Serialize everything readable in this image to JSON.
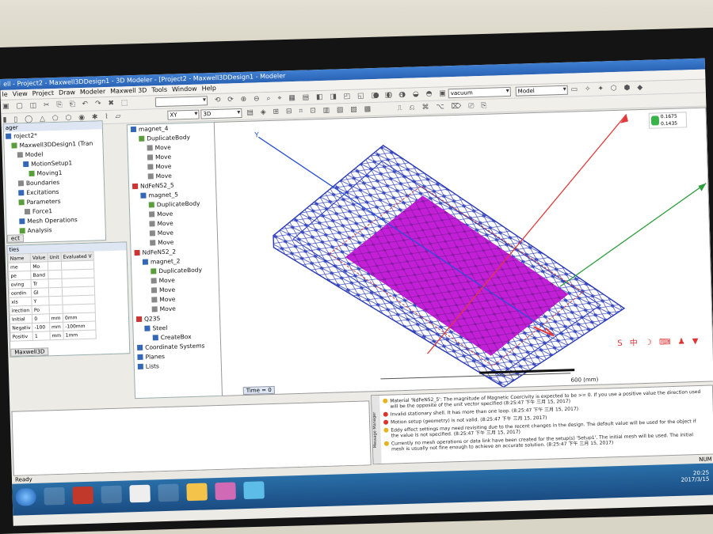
{
  "window": {
    "title": "ell - Project2 - Maxwell3DDesign1 - 3D Modeler - [Project2 - Maxwell3DDesign1 - Modeler"
  },
  "menu": [
    "le",
    "View",
    "Project",
    "Draw",
    "Modeler",
    "Maxwell 3D",
    "Tools",
    "Window",
    "Help"
  ],
  "toolbar": {
    "material_combo": "vacuum",
    "model_combo": "Model",
    "zoom_combo": "3D",
    "grid_combo": "XY"
  },
  "project_manager": {
    "header": "ager",
    "items": [
      "roject2*",
      "Maxwell3DDesign1 (Tran",
      "Model",
      "MotionSetup1",
      "Moving1",
      "Boundaries",
      "Excitations",
      "Parameters",
      "Force1",
      "Mesh Operations",
      "Analysis"
    ],
    "tab": "ect"
  },
  "properties": {
    "header": "ties",
    "columns": [
      "Name",
      "Value",
      "Unit",
      "Evaluated V"
    ],
    "rows": [
      [
        "me",
        "Mo",
        "",
        ""
      ],
      [
        "pe",
        "Band",
        "",
        ""
      ],
      [
        "oving",
        "Tr",
        "",
        ""
      ],
      [
        "oordin",
        "Gl",
        "",
        ""
      ],
      [
        "xis",
        "Y",
        "",
        ""
      ],
      [
        "irection",
        "Po",
        "",
        ""
      ],
      [
        "Initial",
        "0",
        "mm",
        "0mm"
      ],
      [
        "Negativ",
        "-100",
        "mm",
        "-100mm"
      ],
      [
        "Positiv",
        "1",
        "mm",
        "1mm"
      ]
    ],
    "tab": "Maxwell3D"
  },
  "history_tree": {
    "items": [
      {
        "label": "magnet_4",
        "indent": 0
      },
      {
        "label": "DuplicateBody",
        "indent": 1
      },
      {
        "label": "Move",
        "indent": 2
      },
      {
        "label": "Move",
        "indent": 2
      },
      {
        "label": "Move",
        "indent": 2
      },
      {
        "label": "Move",
        "indent": 2
      },
      {
        "label": "NdFeN52_5",
        "indent": 0
      },
      {
        "label": "magnet_5",
        "indent": 1
      },
      {
        "label": "DuplicateBody",
        "indent": 2
      },
      {
        "label": "Move",
        "indent": 2
      },
      {
        "label": "Move",
        "indent": 2
      },
      {
        "label": "Move",
        "indent": 2
      },
      {
        "label": "Move",
        "indent": 2
      },
      {
        "label": "NdFeN52_2",
        "indent": 0
      },
      {
        "label": "magnet_2",
        "indent": 1
      },
      {
        "label": "DuplicateBody",
        "indent": 2
      },
      {
        "label": "Move",
        "indent": 2
      },
      {
        "label": "Move",
        "indent": 2
      },
      {
        "label": "Move",
        "indent": 2
      },
      {
        "label": "Move",
        "indent": 2
      },
      {
        "label": "Q235",
        "indent": 0
      },
      {
        "label": "Steel",
        "indent": 1
      },
      {
        "label": "CreateBox",
        "indent": 2
      },
      {
        "label": "Coordinate Systems",
        "indent": 0
      },
      {
        "label": "Planes",
        "indent": 0
      },
      {
        "label": "Lists",
        "indent": 0
      }
    ]
  },
  "viewport": {
    "axis_y_label": "Y",
    "scale_label": "600 (mm)",
    "time_label": "Time = 0",
    "legend_values": [
      "0.1675",
      "0.1435"
    ]
  },
  "messages": {
    "lines": [
      {
        "type": "warn",
        "text": "Material 'NdFeN52_5': The magnitude of Magnetic Coercivity is expected to be >= 0. If you use a positive value the direction used will be the opposite of the unit vector specified (8:25:47 下午 三月 15, 2017)"
      },
      {
        "type": "error",
        "text": "Invalid stationary shell. It has more than one loop. (8:25:47 下午 三月 15, 2017)"
      },
      {
        "type": "error",
        "text": "Motion setup (geometry) is not valid. (8:25:47 下午 三月 15, 2017)"
      },
      {
        "type": "warn",
        "text": "Eddy effect settings may need revisiting due to the recent changes in the design. The default value will be used for the object if the value is not specified. (8:25:47 下午 三月 15, 2017)"
      },
      {
        "type": "warn",
        "text": "Currently no mesh operations or data link have been created for the setup(s) 'Setup1'. The initial mesh will be used. The initial mesh is usually not fine enough to achieve an accurate solution. (8:25:47 下午 三月 15, 2017)"
      }
    ],
    "side_label": "Message Manager"
  },
  "status": {
    "text": "Ready",
    "right": "NUM"
  },
  "taskbar": {
    "time": "20:25",
    "date": "2017/3/15"
  },
  "colors": {
    "magnet_fill": "#c21fd6",
    "mesh_line": "#2a3ab8",
    "x_axis": "#e23a3a",
    "z_axis": "#2f9e3f",
    "y_axis": "#2b4fd6"
  }
}
